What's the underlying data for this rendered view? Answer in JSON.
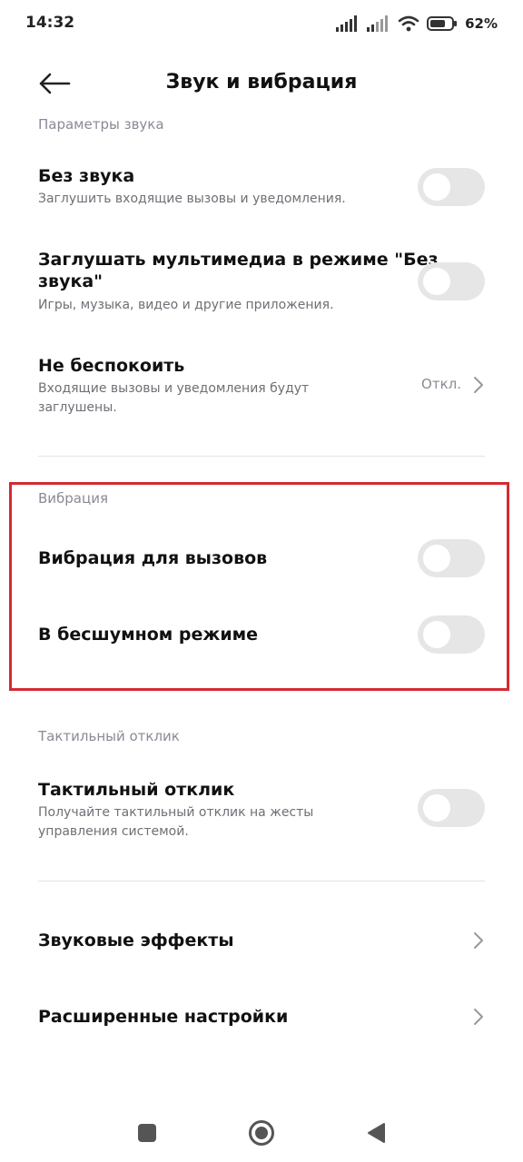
{
  "status": {
    "time": "14:32",
    "battery": "62%",
    "icons": [
      "signal-icon",
      "signal-icon",
      "wifi-icon",
      "battery-icon"
    ]
  },
  "header": {
    "title": "Звук и вибрация",
    "back_icon": "arrow-left-icon"
  },
  "sections": {
    "sound_params": {
      "header": "Параметры звука",
      "mute": {
        "title": "Без звука",
        "subtitle": "Заглушить входящие вызовы и уведомления.",
        "enabled": false
      },
      "mute_media": {
        "title_line1": "Заглушать мультимедиа в режиме \"Без",
        "title_line2": "звука\"",
        "subtitle": "Игры, музыка, видео и другие приложения.",
        "enabled": false
      },
      "dnd": {
        "title": "Не беспокоить",
        "subtitle_line1": "Входящие вызовы и уведомления будут",
        "subtitle_line2": "заглушены.",
        "value": "Откл."
      }
    },
    "vibration": {
      "header": "Вибрация",
      "calls": {
        "title": "Вибрация для вызовов",
        "enabled": false
      },
      "silent": {
        "title": "В бесшумном режиме",
        "enabled": false
      }
    },
    "haptics": {
      "header": "Тактильный отклик",
      "haptic": {
        "title": "Тактильный отклик",
        "subtitle_line1": "Получайте тактильный отклик на жесты",
        "subtitle_line2": "управления системой.",
        "enabled": false
      }
    },
    "more": {
      "sound_effects": "Звуковые эффекты",
      "advanced": "Расширенные настройки"
    }
  },
  "colors": {
    "highlight": "#d42a32",
    "toggle_off": "#e6e6e6",
    "secondary_text": "#8a8a96"
  },
  "nav": {
    "icons": [
      "square-icon",
      "circle-home-icon",
      "triangle-back-icon"
    ]
  }
}
